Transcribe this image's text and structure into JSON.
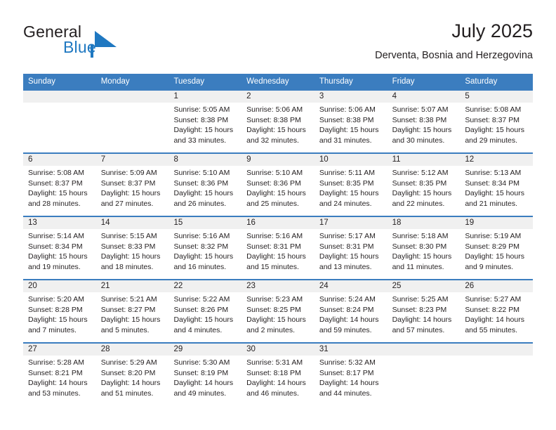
{
  "brand": {
    "word1": "General",
    "word2": "Blue",
    "triangle_color": "#1f78c1",
    "text_color": "#231f20"
  },
  "header": {
    "title": "July 2025",
    "subtitle": "Derventa, Bosnia and Herzegovina"
  },
  "theme": {
    "header_blue": "#3b7dbf",
    "day_band_gray": "#f0f0f0",
    "text": "#231f20"
  },
  "calendar": {
    "day_names": [
      "Sunday",
      "Monday",
      "Tuesday",
      "Wednesday",
      "Thursday",
      "Friday",
      "Saturday"
    ],
    "weeks": [
      [
        {
          "day": "",
          "lines": []
        },
        {
          "day": "",
          "lines": []
        },
        {
          "day": "1",
          "lines": [
            "Sunrise: 5:05 AM",
            "Sunset: 8:38 PM",
            "Daylight: 15 hours",
            "and 33 minutes."
          ]
        },
        {
          "day": "2",
          "lines": [
            "Sunrise: 5:06 AM",
            "Sunset: 8:38 PM",
            "Daylight: 15 hours",
            "and 32 minutes."
          ]
        },
        {
          "day": "3",
          "lines": [
            "Sunrise: 5:06 AM",
            "Sunset: 8:38 PM",
            "Daylight: 15 hours",
            "and 31 minutes."
          ]
        },
        {
          "day": "4",
          "lines": [
            "Sunrise: 5:07 AM",
            "Sunset: 8:38 PM",
            "Daylight: 15 hours",
            "and 30 minutes."
          ]
        },
        {
          "day": "5",
          "lines": [
            "Sunrise: 5:08 AM",
            "Sunset: 8:37 PM",
            "Daylight: 15 hours",
            "and 29 minutes."
          ]
        }
      ],
      [
        {
          "day": "6",
          "lines": [
            "Sunrise: 5:08 AM",
            "Sunset: 8:37 PM",
            "Daylight: 15 hours",
            "and 28 minutes."
          ]
        },
        {
          "day": "7",
          "lines": [
            "Sunrise: 5:09 AM",
            "Sunset: 8:37 PM",
            "Daylight: 15 hours",
            "and 27 minutes."
          ]
        },
        {
          "day": "8",
          "lines": [
            "Sunrise: 5:10 AM",
            "Sunset: 8:36 PM",
            "Daylight: 15 hours",
            "and 26 minutes."
          ]
        },
        {
          "day": "9",
          "lines": [
            "Sunrise: 5:10 AM",
            "Sunset: 8:36 PM",
            "Daylight: 15 hours",
            "and 25 minutes."
          ]
        },
        {
          "day": "10",
          "lines": [
            "Sunrise: 5:11 AM",
            "Sunset: 8:35 PM",
            "Daylight: 15 hours",
            "and 24 minutes."
          ]
        },
        {
          "day": "11",
          "lines": [
            "Sunrise: 5:12 AM",
            "Sunset: 8:35 PM",
            "Daylight: 15 hours",
            "and 22 minutes."
          ]
        },
        {
          "day": "12",
          "lines": [
            "Sunrise: 5:13 AM",
            "Sunset: 8:34 PM",
            "Daylight: 15 hours",
            "and 21 minutes."
          ]
        }
      ],
      [
        {
          "day": "13",
          "lines": [
            "Sunrise: 5:14 AM",
            "Sunset: 8:34 PM",
            "Daylight: 15 hours",
            "and 19 minutes."
          ]
        },
        {
          "day": "14",
          "lines": [
            "Sunrise: 5:15 AM",
            "Sunset: 8:33 PM",
            "Daylight: 15 hours",
            "and 18 minutes."
          ]
        },
        {
          "day": "15",
          "lines": [
            "Sunrise: 5:16 AM",
            "Sunset: 8:32 PM",
            "Daylight: 15 hours",
            "and 16 minutes."
          ]
        },
        {
          "day": "16",
          "lines": [
            "Sunrise: 5:16 AM",
            "Sunset: 8:31 PM",
            "Daylight: 15 hours",
            "and 15 minutes."
          ]
        },
        {
          "day": "17",
          "lines": [
            "Sunrise: 5:17 AM",
            "Sunset: 8:31 PM",
            "Daylight: 15 hours",
            "and 13 minutes."
          ]
        },
        {
          "day": "18",
          "lines": [
            "Sunrise: 5:18 AM",
            "Sunset: 8:30 PM",
            "Daylight: 15 hours",
            "and 11 minutes."
          ]
        },
        {
          "day": "19",
          "lines": [
            "Sunrise: 5:19 AM",
            "Sunset: 8:29 PM",
            "Daylight: 15 hours",
            "and 9 minutes."
          ]
        }
      ],
      [
        {
          "day": "20",
          "lines": [
            "Sunrise: 5:20 AM",
            "Sunset: 8:28 PM",
            "Daylight: 15 hours",
            "and 7 minutes."
          ]
        },
        {
          "day": "21",
          "lines": [
            "Sunrise: 5:21 AM",
            "Sunset: 8:27 PM",
            "Daylight: 15 hours",
            "and 5 minutes."
          ]
        },
        {
          "day": "22",
          "lines": [
            "Sunrise: 5:22 AM",
            "Sunset: 8:26 PM",
            "Daylight: 15 hours",
            "and 4 minutes."
          ]
        },
        {
          "day": "23",
          "lines": [
            "Sunrise: 5:23 AM",
            "Sunset: 8:25 PM",
            "Daylight: 15 hours",
            "and 2 minutes."
          ]
        },
        {
          "day": "24",
          "lines": [
            "Sunrise: 5:24 AM",
            "Sunset: 8:24 PM",
            "Daylight: 14 hours",
            "and 59 minutes."
          ]
        },
        {
          "day": "25",
          "lines": [
            "Sunrise: 5:25 AM",
            "Sunset: 8:23 PM",
            "Daylight: 14 hours",
            "and 57 minutes."
          ]
        },
        {
          "day": "26",
          "lines": [
            "Sunrise: 5:27 AM",
            "Sunset: 8:22 PM",
            "Daylight: 14 hours",
            "and 55 minutes."
          ]
        }
      ],
      [
        {
          "day": "27",
          "lines": [
            "Sunrise: 5:28 AM",
            "Sunset: 8:21 PM",
            "Daylight: 14 hours",
            "and 53 minutes."
          ]
        },
        {
          "day": "28",
          "lines": [
            "Sunrise: 5:29 AM",
            "Sunset: 8:20 PM",
            "Daylight: 14 hours",
            "and 51 minutes."
          ]
        },
        {
          "day": "29",
          "lines": [
            "Sunrise: 5:30 AM",
            "Sunset: 8:19 PM",
            "Daylight: 14 hours",
            "and 49 minutes."
          ]
        },
        {
          "day": "30",
          "lines": [
            "Sunrise: 5:31 AM",
            "Sunset: 8:18 PM",
            "Daylight: 14 hours",
            "and 46 minutes."
          ]
        },
        {
          "day": "31",
          "lines": [
            "Sunrise: 5:32 AM",
            "Sunset: 8:17 PM",
            "Daylight: 14 hours",
            "and 44 minutes."
          ]
        },
        {
          "day": "",
          "lines": []
        },
        {
          "day": "",
          "lines": []
        }
      ]
    ]
  }
}
